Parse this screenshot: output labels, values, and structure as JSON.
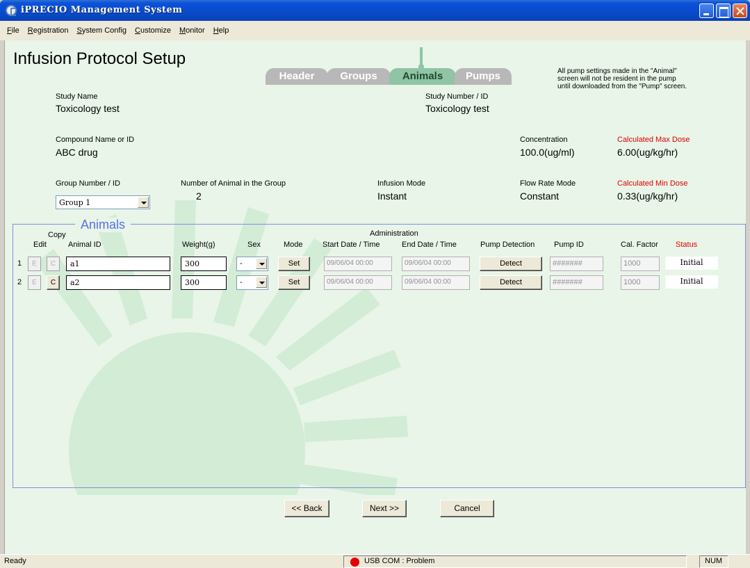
{
  "window": {
    "title": "iPRECIO Management System"
  },
  "menu": [
    {
      "label": "File",
      "u": "F",
      "rest": "ile"
    },
    {
      "label": "Registration",
      "u": "R",
      "rest": "egistration"
    },
    {
      "label": "System Config",
      "u": "S",
      "rest": "ystem Config"
    },
    {
      "label": "Customize",
      "u": "C",
      "rest": "ustomize"
    },
    {
      "label": "Monitor",
      "u": "M",
      "rest": "onitor"
    },
    {
      "label": "Help",
      "u": "H",
      "rest": "elp"
    }
  ],
  "page": {
    "title": "Infusion Protocol Setup",
    "tabs": {
      "header": "Header",
      "groups": "Groups",
      "animals": "Animals",
      "pumps": "Pumps"
    },
    "note": [
      "All pump settings made in the \"Animal\"",
      "screen will not be resident in the pump",
      "until downloaded from the \"Pump\" screen."
    ]
  },
  "study": {
    "name_label": "Study Name",
    "name": "Toxicology test",
    "number_label": "Study Number / ID",
    "number": "Toxicology test",
    "compound_label": "Compound Name or ID",
    "compound": "ABC drug",
    "concentration_label": "Concentration",
    "concentration": "100.0(ug/ml)",
    "max_dose_label": "Calculated Max Dose",
    "max_dose": "6.00(ug/kg/hr)",
    "group_label": "Group Number / ID",
    "group": "Group 1",
    "animals_count_label": "Number of Animal in the Group",
    "animals_count": "2",
    "infusion_mode_label": "Infusion Mode",
    "infusion_mode": "Instant",
    "flow_rate_label": "Flow Rate Mode",
    "flow_rate": "Constant",
    "min_dose_label": "Calculated Min Dose",
    "min_dose": "0.33(ug/kg/hr)"
  },
  "animals": {
    "section_title": "Animals",
    "headers": {
      "copy": "Copy",
      "edit": "Edit",
      "animal_id": "Animal ID",
      "weight": "Weight(g)",
      "sex": "Sex",
      "mode": "Mode",
      "administration": "Administration",
      "start": "Start Date / Time",
      "end": "End Date / Time",
      "pump_detection": "Pump Detection",
      "pump_id": "Pump ID",
      "cal_factor": "Cal. Factor",
      "status": "Status"
    },
    "rows": [
      {
        "num": "1",
        "edit": "E",
        "copy": "C",
        "id": "a1",
        "weight": "300",
        "sex": "-",
        "mode": "Set",
        "start": "09/06/04 00:00",
        "end": "09/06/04 00:00",
        "detect": "Detect",
        "pump_id": "#######",
        "cal": "1000",
        "status": "Initial"
      },
      {
        "num": "2",
        "edit": "E",
        "copy": "C",
        "id": "a2",
        "weight": "300",
        "sex": "-",
        "mode": "Set",
        "start": "09/06/04 00:00",
        "end": "09/06/04 00:00",
        "detect": "Detect",
        "pump_id": "#######",
        "cal": "1000",
        "status": "Initial"
      }
    ]
  },
  "nav": {
    "back": "<< Back",
    "next": "Next >>",
    "cancel": "Cancel"
  },
  "statusbar": {
    "ready": "Ready",
    "usb": "USB COM : Problem",
    "num": "NUM"
  },
  "colors": {
    "accent_green": "#8fc4a4",
    "alert_red": "#e00000",
    "section_blue": "#5b6ee6"
  }
}
